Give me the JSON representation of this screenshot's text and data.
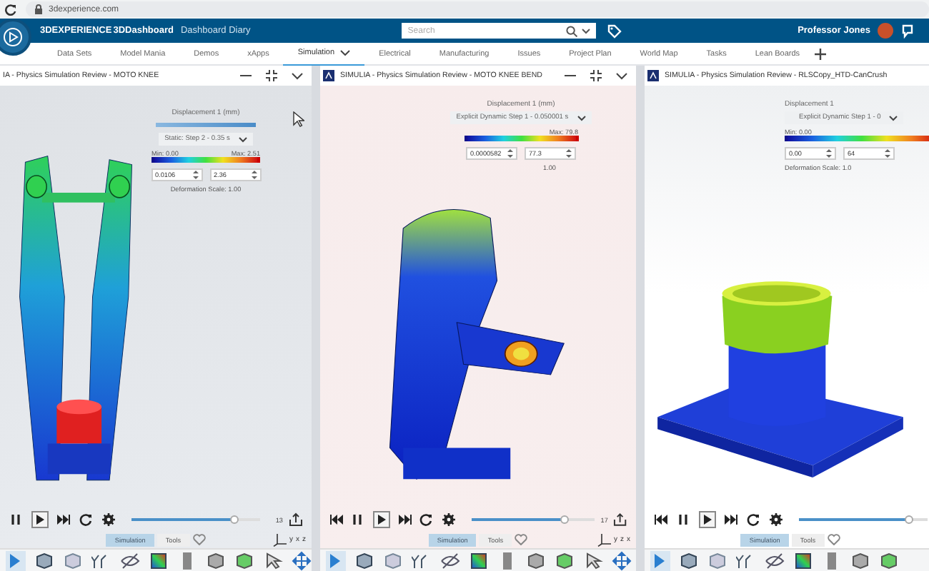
{
  "browser": {
    "address": "3dexperience.com"
  },
  "header": {
    "brand": "3DEXPERIENCE",
    "app": "3DDashboard",
    "dashboard": "Dashboard Diary",
    "search": {
      "placeholder": "Search"
    },
    "user": "Professor Jones"
  },
  "tabs": [
    {
      "label": "Data Sets",
      "selected": false
    },
    {
      "label": "Model Mania",
      "selected": false
    },
    {
      "label": "Demos",
      "selected": false
    },
    {
      "label": "xApps",
      "selected": false
    },
    {
      "label": "Simulation",
      "selected": true
    },
    {
      "label": "Electrical",
      "selected": false
    },
    {
      "label": "Manufacturing",
      "selected": false
    },
    {
      "label": "Issues",
      "selected": false
    },
    {
      "label": "Project Plan",
      "selected": false
    },
    {
      "label": "World Map",
      "selected": false
    },
    {
      "label": "Tasks",
      "selected": false
    },
    {
      "label": "Lean Boards",
      "selected": false
    }
  ],
  "panels": [
    {
      "kind": "knee",
      "title": "IA - Physics Simulation Review - MOTO KNEE",
      "app_icon": false,
      "legend": {
        "title": "Displacement 1 (mm)",
        "step": "Static: Step 2 - 0.35 s",
        "min": "Min: 0.00",
        "max": "Max: 2.51",
        "low": "0.0106",
        "high": "2.36",
        "scale": "Deformation Scale: 1.00"
      },
      "playback": {
        "buttons": [
          {
            "kind": "pause",
            "selected": false
          },
          {
            "kind": "play",
            "selected": true
          },
          {
            "kind": "forward",
            "selected": false
          },
          {
            "kind": "loop",
            "selected": false
          },
          {
            "kind": "settings",
            "selected": false
          }
        ],
        "level": 0.8,
        "frame": "13"
      },
      "axes": [
        "y",
        "x",
        "z"
      ],
      "bottom_tabs": [
        {
          "label": "Simulation",
          "selected": true
        },
        {
          "label": "Tools",
          "selected": false
        }
      ]
    },
    {
      "kind": "bend",
      "title": "SIMULIA - Physics Simulation Review - MOTO KNEE BEND",
      "app_icon": true,
      "legend": {
        "title": "Displacement 1 (mm)",
        "step": "Explicit Dynamic Step 1 - 0.050001 s",
        "max": "Max: 79.8",
        "low": "0.0000582",
        "high": "77.3",
        "scale": "1.00"
      },
      "playback": {
        "buttons": [
          {
            "kind": "rewind",
            "selected": false
          },
          {
            "kind": "pause",
            "selected": false
          },
          {
            "kind": "play",
            "selected": true
          },
          {
            "kind": "forward",
            "selected": false
          },
          {
            "kind": "loop",
            "selected": false
          },
          {
            "kind": "settings",
            "selected": false
          }
        ],
        "level": 0.75,
        "frame": "17"
      },
      "axes": [
        "y",
        "z",
        "x"
      ],
      "bottom_tabs": [
        {
          "label": "Simulation",
          "selected": true
        },
        {
          "label": "Tools",
          "selected": false
        }
      ]
    },
    {
      "kind": "can",
      "title": "SIMULIA - Physics Simulation Review - RLSCopy_HTD-CanCrush",
      "app_icon": true,
      "legend": {
        "title": "Displacement 1",
        "step": "Explicit Dynamic Step 1 - 0",
        "min": "Min: 0.00",
        "low": "0.00",
        "high": "64",
        "scale": "Deformation Scale: 1.0"
      },
      "playback": {
        "buttons": [
          {
            "kind": "rewind",
            "selected": false
          },
          {
            "kind": "pause",
            "selected": false
          },
          {
            "kind": "play",
            "selected": true
          },
          {
            "kind": "forward",
            "selected": false
          },
          {
            "kind": "loop",
            "selected": false
          },
          {
            "kind": "settings",
            "selected": false
          }
        ],
        "level": 0.85
      },
      "bottom_tabs": [
        {
          "label": "Simulation",
          "selected": true
        },
        {
          "label": "Tools",
          "selected": false
        }
      ]
    }
  ]
}
